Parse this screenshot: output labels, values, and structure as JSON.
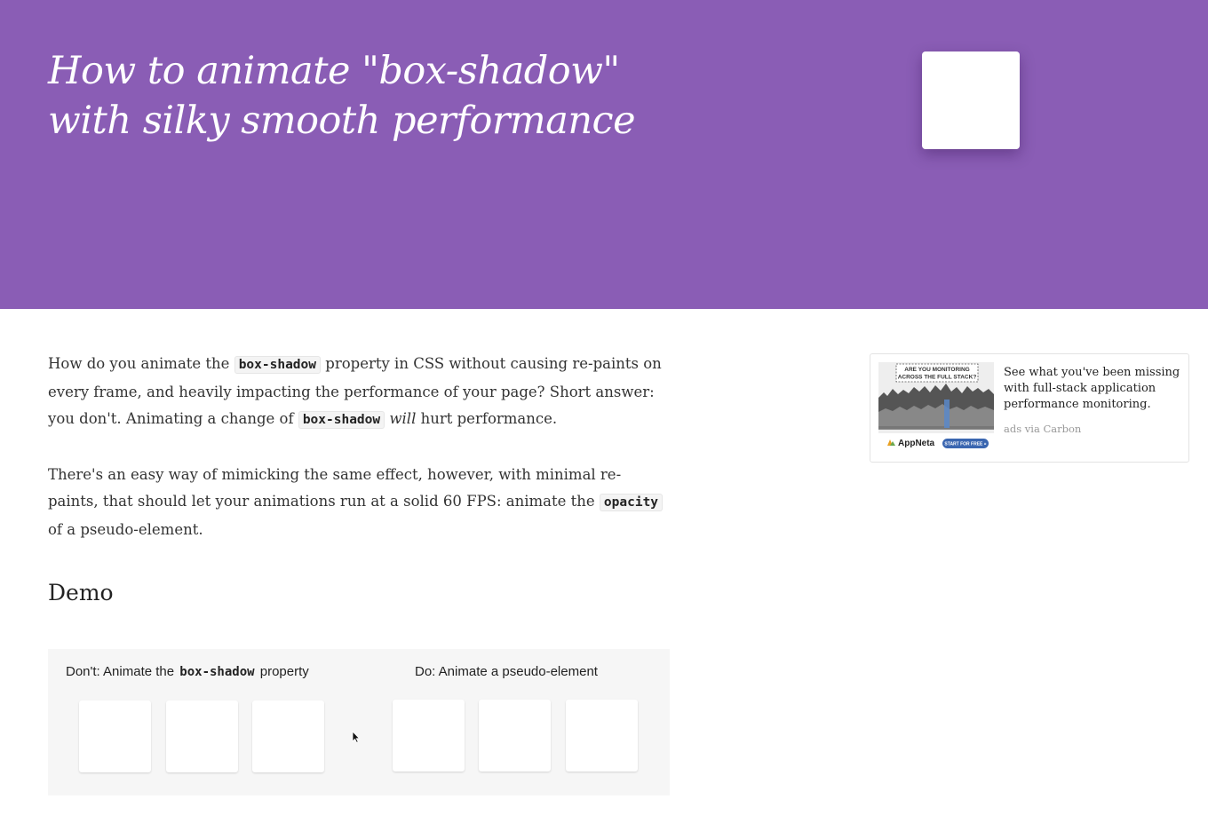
{
  "hero": {
    "title_line1": "How to animate \"box-shadow\"",
    "title_line2": "with silky smooth performance",
    "background_color": "#8a5db5"
  },
  "intro": {
    "p1": {
      "t1": "How do you animate the ",
      "code1": "box-shadow",
      "t2": " property in CSS without causing re-paints on every frame, and heavily impacting the performance of your page? Short answer: you don't. Animating a change of ",
      "code2": "box-shadow",
      "t3": " ",
      "em": "will",
      "t4": " hurt performance."
    },
    "p2": {
      "t1": "There's an easy way of mimicking the same effect, however, with minimal re-paints, that should let your animations run at a solid 60 FPS: animate the ",
      "code": "opacity",
      "t2": " of a pseudo-element."
    }
  },
  "demo": {
    "heading": "Demo",
    "dont_label_prefix": "Don't: Animate the ",
    "dont_label_code": "box-shadow",
    "dont_label_suffix": " property",
    "do_label": "Do: Animate a pseudo-element"
  },
  "ad": {
    "image_headline_line1": "ARE YOU MONITORING",
    "image_headline_line2": "ACROSS THE FULL STACK?",
    "image_brand": "AppNeta",
    "image_cta": "START FOR FREE »",
    "text": "See what you've been missing with full-stack application performance monitoring.",
    "via": "ads via Carbon"
  }
}
